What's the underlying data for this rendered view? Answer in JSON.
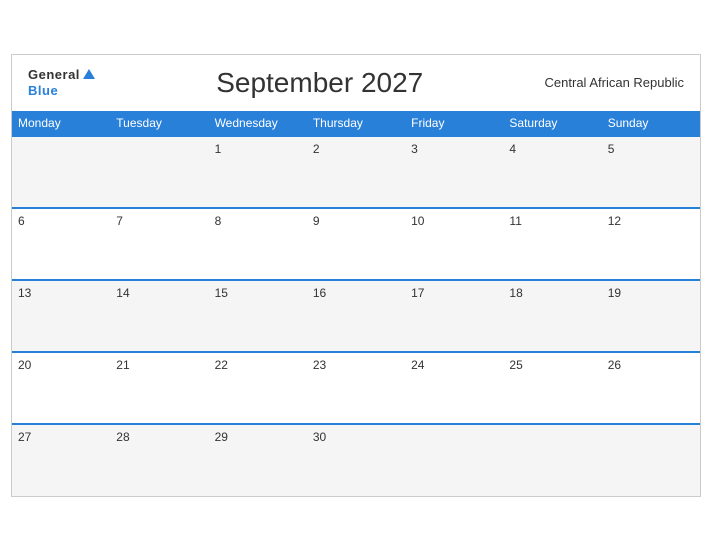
{
  "header": {
    "logo_general": "General",
    "logo_blue": "Blue",
    "title": "September 2027",
    "region": "Central African Republic"
  },
  "weekdays": [
    "Monday",
    "Tuesday",
    "Wednesday",
    "Thursday",
    "Friday",
    "Saturday",
    "Sunday"
  ],
  "weeks": [
    [
      "",
      "",
      "1",
      "2",
      "3",
      "4",
      "5"
    ],
    [
      "6",
      "7",
      "8",
      "9",
      "10",
      "11",
      "12"
    ],
    [
      "13",
      "14",
      "15",
      "16",
      "17",
      "18",
      "19"
    ],
    [
      "20",
      "21",
      "22",
      "23",
      "24",
      "25",
      "26"
    ],
    [
      "27",
      "28",
      "29",
      "30",
      "",
      "",
      ""
    ]
  ]
}
